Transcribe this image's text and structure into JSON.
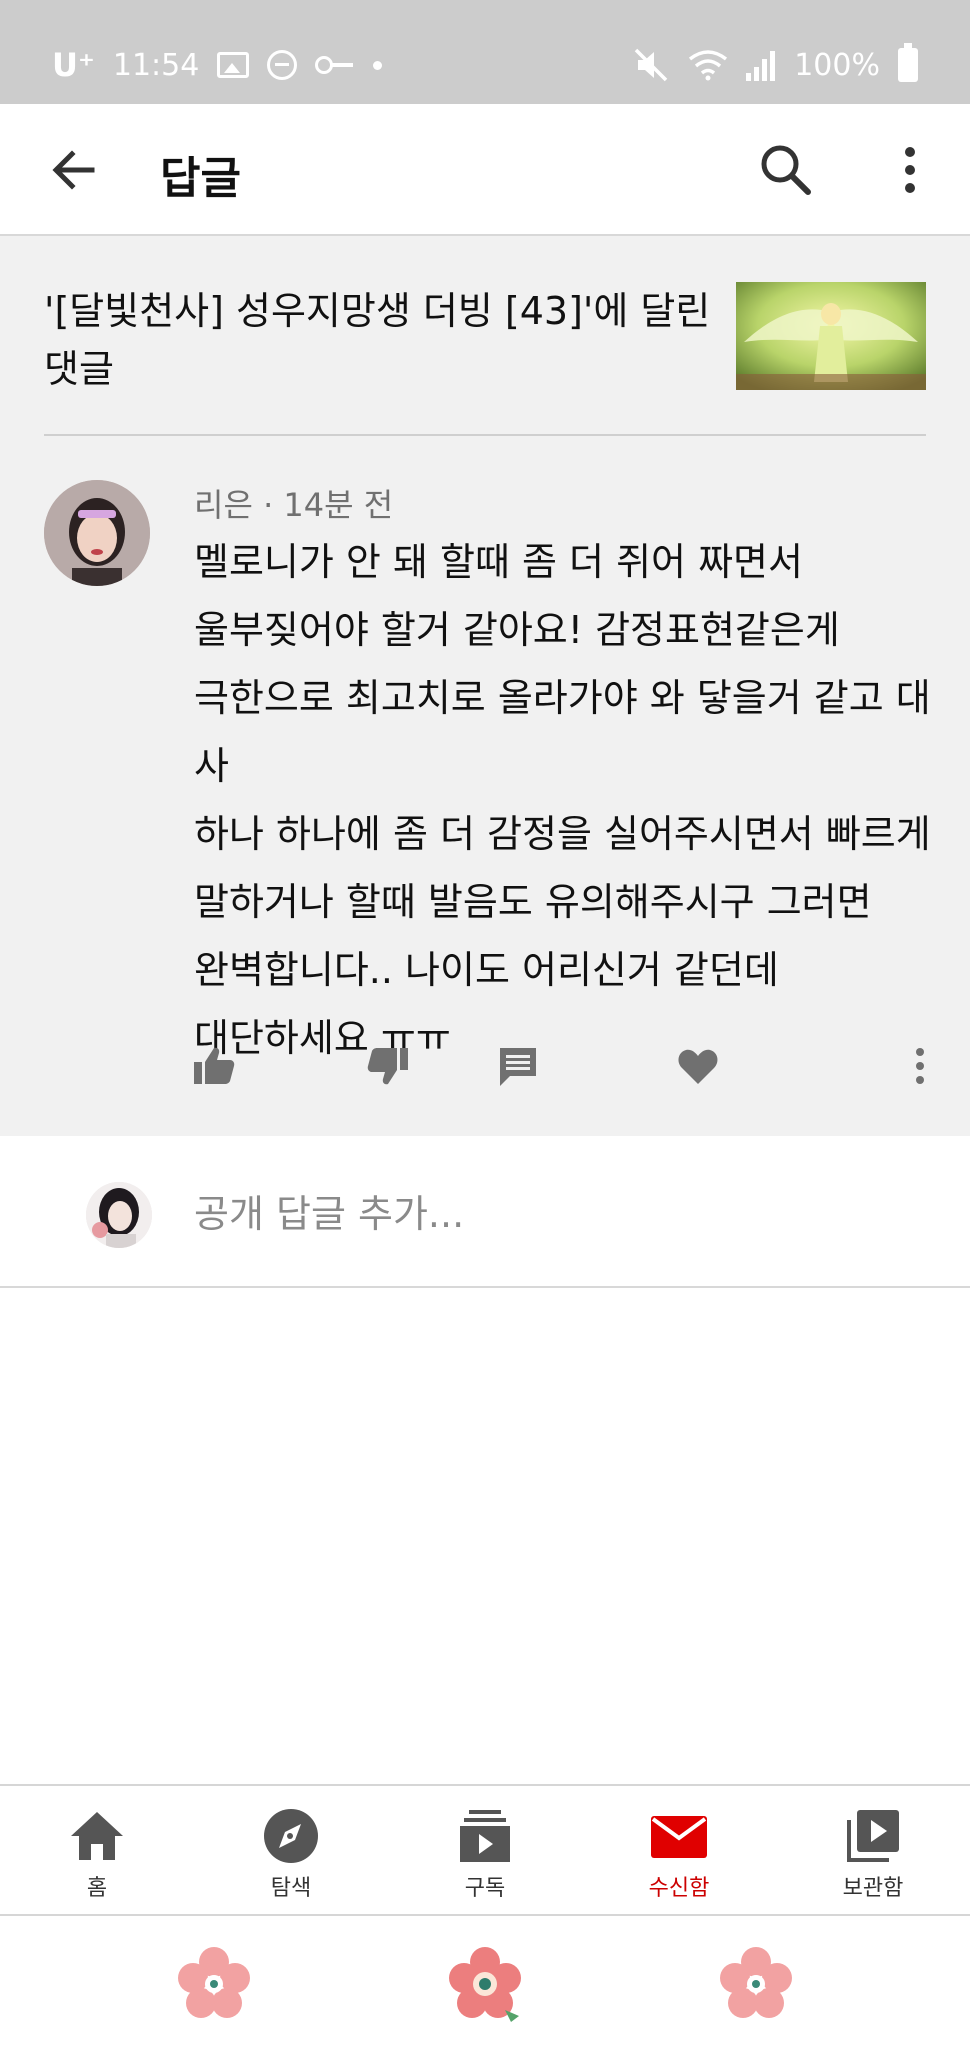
{
  "status_bar": {
    "carrier": "U⁺",
    "time": "11:54",
    "battery_text": "100%"
  },
  "app_bar": {
    "title": "답글"
  },
  "context": {
    "video_reference": "'[달빛천사] 성우지망생 더빙 [43]'에 달린 댓글"
  },
  "comment": {
    "author": "리은",
    "separator": " · ",
    "time_ago": "14분 전",
    "text": "멜로니가 안 돼 할때 좀 더 쥐어 짜면서\n울부짖어야 할거 같아요! 감정표현같은게\n극한으로 최고치로 올라가야 와 닿을거 같고 대사\n하나 하나에 좀 더 감정을 실어주시면서 빠르게\n말하거나 할때 발음도 유의해주시구 그러면\n완벽합니다.. 나이도 어리신거 같던데\n대단하세요 ㅠㅠ"
  },
  "reply": {
    "placeholder": "공개 답글 추가..."
  },
  "bottom_nav": {
    "items": [
      {
        "label": "홈",
        "icon": "home-icon"
      },
      {
        "label": "탐색",
        "icon": "explore-icon"
      },
      {
        "label": "구독",
        "icon": "subscriptions-icon"
      },
      {
        "label": "수신함",
        "icon": "inbox-icon"
      },
      {
        "label": "보관함",
        "icon": "library-icon"
      }
    ],
    "active_index": 3
  },
  "colors": {
    "accent": "#cc0000",
    "status_bar_bg": "#cccccc",
    "context_bg": "#f1f1f1"
  }
}
